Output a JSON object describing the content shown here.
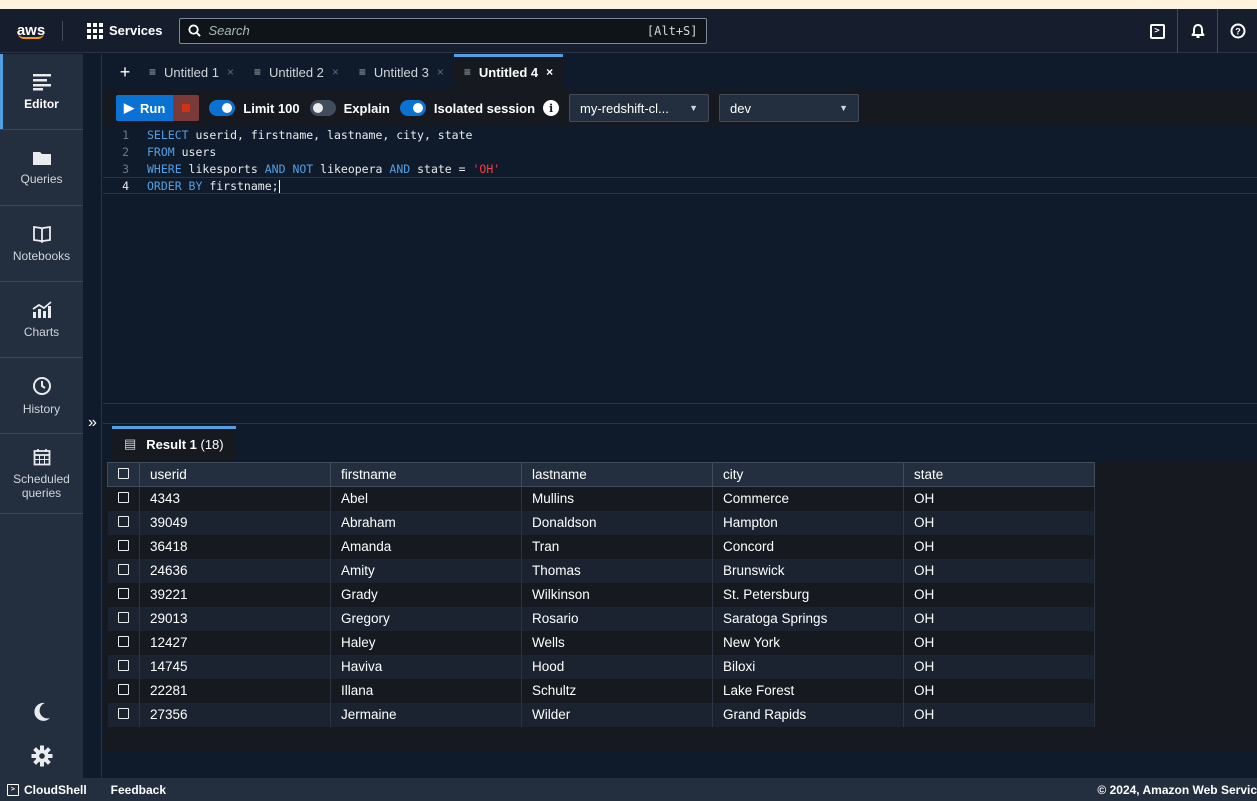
{
  "topnav": {
    "logo": "aws",
    "services_label": "Services",
    "search_placeholder": "Search",
    "search_shortcut": "[Alt+S]"
  },
  "sidebar": {
    "items": [
      {
        "label": "Editor",
        "icon": "editor-icon"
      },
      {
        "label": "Queries",
        "icon": "folder-icon"
      },
      {
        "label": "Notebooks",
        "icon": "book-icon"
      },
      {
        "label": "Charts",
        "icon": "chart-icon"
      },
      {
        "label": "History",
        "icon": "clock-icon"
      },
      {
        "label": "Scheduled queries",
        "icon": "calendar-icon"
      }
    ],
    "collapse_glyph": "»"
  },
  "tabs": [
    {
      "label": "Untitled 1",
      "active": false
    },
    {
      "label": "Untitled 2",
      "active": false
    },
    {
      "label": "Untitled 3",
      "active": false
    },
    {
      "label": "Untitled 4",
      "active": true
    }
  ],
  "toolbar": {
    "run_label": "Run",
    "limit_label": "Limit 100",
    "limit_on": true,
    "explain_label": "Explain",
    "explain_on": false,
    "isolated_label": "Isolated session",
    "isolated_on": true,
    "cluster": "my-redshift-cl...",
    "database": "dev"
  },
  "editor": {
    "lines": [
      "SELECT userid, firstname, lastname, city, state",
      "FROM users",
      "WHERE likesports AND NOT likeopera AND state = 'OH'",
      "ORDER BY firstname;"
    ]
  },
  "results": {
    "tab_label": "Result 1",
    "tab_count": "(18)",
    "columns": [
      "userid",
      "firstname",
      "lastname",
      "city",
      "state"
    ],
    "rows": [
      [
        "4343",
        "Abel",
        "Mullins",
        "Commerce",
        "OH"
      ],
      [
        "39049",
        "Abraham",
        "Donaldson",
        "Hampton",
        "OH"
      ],
      [
        "36418",
        "Amanda",
        "Tran",
        "Concord",
        "OH"
      ],
      [
        "24636",
        "Amity",
        "Thomas",
        "Brunswick",
        "OH"
      ],
      [
        "39221",
        "Grady",
        "Wilkinson",
        "St. Petersburg",
        "OH"
      ],
      [
        "29013",
        "Gregory",
        "Rosario",
        "Saratoga Springs",
        "OH"
      ],
      [
        "12427",
        "Haley",
        "Wells",
        "New York",
        "OH"
      ],
      [
        "14745",
        "Haviva",
        "Hood",
        "Biloxi",
        "OH"
      ],
      [
        "22281",
        "Illana",
        "Schultz",
        "Lake Forest",
        "OH"
      ],
      [
        "27356",
        "Jermaine",
        "Wilder",
        "Grand Rapids",
        "OH"
      ]
    ]
  },
  "footer": {
    "cloudshell": "CloudShell",
    "feedback": "Feedback",
    "copyright": "© 2024, Amazon Web Servic"
  },
  "colors": {
    "accent": "#0972d3",
    "keyword": "#539fe5",
    "string": "#ff3c3c",
    "aws_orange": "#ff9900"
  }
}
